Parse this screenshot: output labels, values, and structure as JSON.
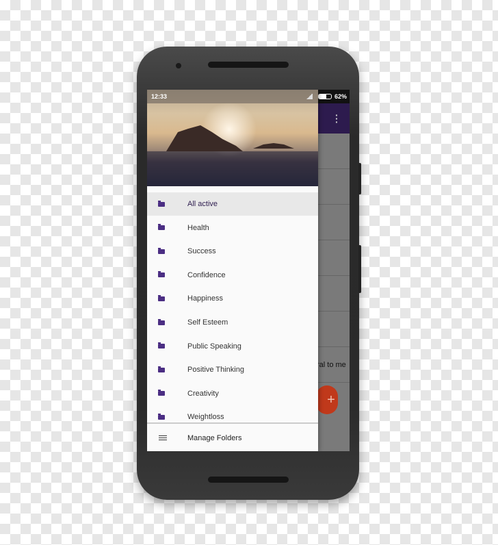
{
  "status": {
    "time": "12:33",
    "battery": "62%"
  },
  "background_row_text": "ral to me",
  "drawer": {
    "items": [
      {
        "label": "All active",
        "active": true
      },
      {
        "label": "Health"
      },
      {
        "label": "Success"
      },
      {
        "label": "Confidence"
      },
      {
        "label": "Happiness"
      },
      {
        "label": "Self Esteem"
      },
      {
        "label": "Public Speaking"
      },
      {
        "label": "Positive Thinking"
      },
      {
        "label": "Creativity"
      },
      {
        "label": "Weightloss"
      }
    ],
    "footer": {
      "label": "Manage Folders",
      "icon": "list-icon"
    }
  },
  "colors": {
    "accent": "#4b2e83",
    "appbar": "#2d1b4e",
    "fab": "#c0391b"
  }
}
